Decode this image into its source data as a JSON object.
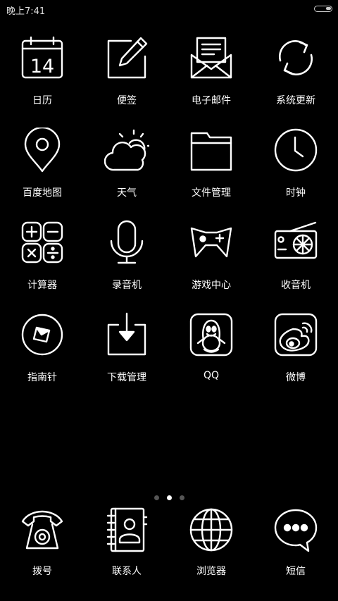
{
  "status_bar": {
    "time": "晚上7:41",
    "battery_icon": "battery-icon"
  },
  "apps": [
    [
      {
        "id": "calendar",
        "label": "日历",
        "icon": "calendar-icon",
        "date": "14"
      },
      {
        "id": "notes",
        "label": "便签",
        "icon": "notes-icon"
      },
      {
        "id": "email",
        "label": "电子邮件",
        "icon": "email-icon"
      },
      {
        "id": "updater",
        "label": "系统更新",
        "icon": "update-icon"
      }
    ],
    [
      {
        "id": "maps",
        "label": "百度地图",
        "icon": "map-pin-icon"
      },
      {
        "id": "weather",
        "label": "天气",
        "icon": "weather-icon"
      },
      {
        "id": "files",
        "label": "文件管理",
        "icon": "folder-icon"
      },
      {
        "id": "clock",
        "label": "时钟",
        "icon": "clock-icon"
      }
    ],
    [
      {
        "id": "calculator",
        "label": "计算器",
        "icon": "calculator-icon"
      },
      {
        "id": "recorder",
        "label": "录音机",
        "icon": "microphone-icon"
      },
      {
        "id": "game-center",
        "label": "游戏中心",
        "icon": "gamepad-icon"
      },
      {
        "id": "radio",
        "label": "收音机",
        "icon": "radio-icon"
      }
    ],
    [
      {
        "id": "compass",
        "label": "指南针",
        "icon": "compass-icon"
      },
      {
        "id": "downloads",
        "label": "下载管理",
        "icon": "download-icon"
      },
      {
        "id": "qq",
        "label": "QQ",
        "icon": "qq-penguin-icon"
      },
      {
        "id": "weibo",
        "label": "微博",
        "icon": "weibo-icon"
      }
    ]
  ],
  "page_indicator": {
    "count": 3,
    "active_index": 1
  },
  "dock": [
    {
      "id": "phone",
      "label": "拨号",
      "icon": "phone-icon"
    },
    {
      "id": "contacts",
      "label": "联系人",
      "icon": "contacts-icon"
    },
    {
      "id": "browser",
      "label": "浏览器",
      "icon": "globe-icon"
    },
    {
      "id": "messages",
      "label": "短信",
      "icon": "message-bubble-icon"
    }
  ]
}
